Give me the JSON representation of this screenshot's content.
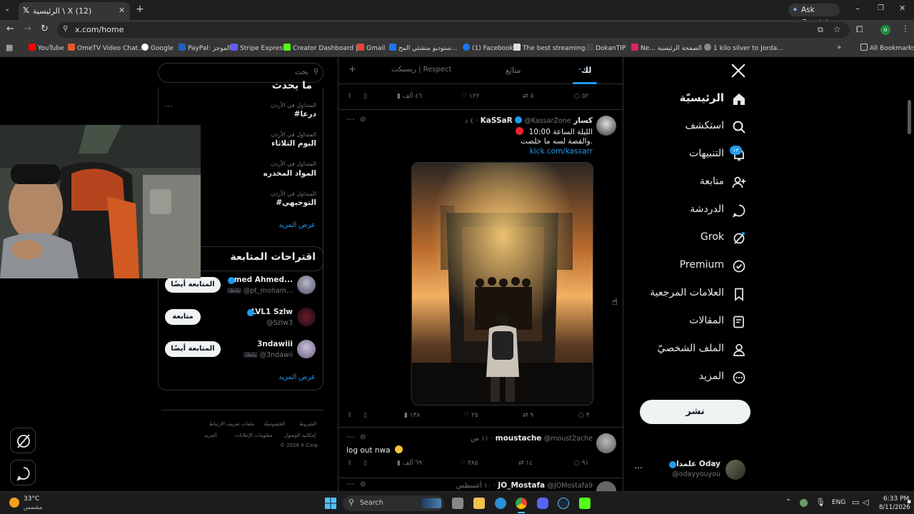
{
  "browser": {
    "tab_title": "(12) X \\ الرئيسية",
    "ask_gemini": "Ask Gemini",
    "url": "x.com/home",
    "bookmarks": [
      "YouTube",
      "OmeTV Video Chat...",
      "Google",
      "PayPal: الموجز",
      "Stripe Express",
      "Creator Dashboard |...",
      "Gmail",
      "ستوديو منشئي المح...",
      "(1) Facebook",
      "The best streaming...",
      "DokanTIP",
      "Ne... الصفحة الرئيسية",
      "1 kilo silver to Jorda..."
    ],
    "all_bookmarks": "All Bookmarks"
  },
  "nav": {
    "items": [
      "الرئيسيّة",
      "استكشف",
      "التنبيهات",
      "متابعة",
      "الدردشة",
      "Grok",
      "Premium",
      "العلامات المرجعية",
      "المقالات",
      "الملف الشخصيّ",
      "المزيد"
    ],
    "notif_badge": "١٢",
    "post_button": "نشر",
    "account_name": "علمدار Oday",
    "account_handle": "@odayyouyou"
  },
  "feed": {
    "tabs": [
      "لك",
      "متابَع",
      "ريسبكت | Respect"
    ],
    "top_actions": {
      "replies": "٥٢",
      "reposts": "٥",
      "likes": "١٢٢",
      "views": "٤٦ ألف"
    },
    "post1": {
      "name": "كسار KaSSaR",
      "handle": "@KassarZone",
      "time": "٤ د",
      "line1": "الليلة الساعة 10:00",
      "line2": "والقصة لسه ما خلصت.",
      "link": "kick.com/kassarr",
      "replies": "٣",
      "reposts": "٩",
      "likes": "٢٥",
      "views": "١٣٨"
    },
    "post2": {
      "name": "moustache",
      "handle": "@moust2ache",
      "time": "١١ س",
      "text": "log out nwa",
      "replies": "٩١",
      "reposts": "١٤",
      "likes": "٣٨٥",
      "views": "٦٩ ألف"
    },
    "post3": {
      "name": "JO_Mostafa",
      "handle": "@JOMostafa9",
      "time": "١٠ أغسطس"
    }
  },
  "sidebar": {
    "search_placeholder": "بحث",
    "trends_header": "ما يحدث",
    "trends": [
      {
        "meta": "المتداول في الأردن",
        "name": "#درعا"
      },
      {
        "meta": "المتداول في الأردن",
        "name": "اليوم الثلاثاء"
      },
      {
        "meta": "المتداول في الأردن",
        "name": "المواد المخدره"
      },
      {
        "meta": "المتداول في الأردن",
        "name": "#التوجيهي"
      }
    ],
    "show_more": "عرض المزيد",
    "follow_header": "اقتراحات المتابعة",
    "suggestions": [
      {
        "name": "amed Ahmed...",
        "handle": "@pt_moham...",
        "follows_you": "يتابعك",
        "button": "المتابعة أيضًا"
      },
      {
        "name": "LVL1 Szlw",
        "handle": "@Szlw3",
        "follows_you": "",
        "button": "متابعة"
      },
      {
        "name": "3ndawiii",
        "handle": "@3ndawii",
        "follows_you": "يتابعك",
        "button": "المتابعة أيضًا"
      }
    ],
    "footer": [
      "الشروط",
      "الخصوصيّة",
      "ملفات تعريف الارتباط",
      "إمكانية الوصول",
      "معلومات الإعلانات",
      "المزيد",
      "© 2026 X Corp."
    ]
  },
  "taskbar": {
    "temp": "33°C",
    "weather": "مشمس",
    "search": "Search",
    "lang": "ENG",
    "time": "6:33 PM",
    "date": "8/11/2026"
  },
  "colors": {
    "accent": "#1d9bf0",
    "live_dot": "#f4212e",
    "background": "#000000"
  }
}
